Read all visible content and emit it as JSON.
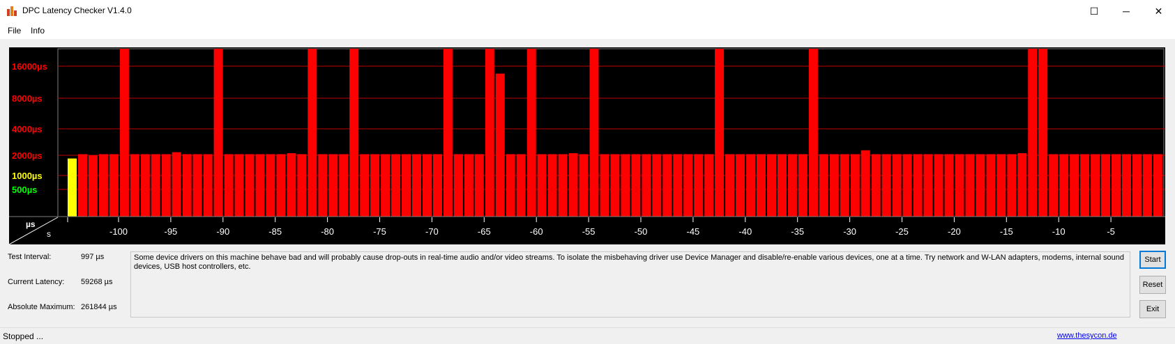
{
  "window": {
    "title": "DPC Latency Checker V1.4.0",
    "controls": {
      "minimize": "─",
      "maximize": "☐",
      "close": "✕"
    }
  },
  "menu": {
    "items": [
      "File",
      "Info"
    ]
  },
  "chart": {
    "y_axis_labels": [
      {
        "text": "16000µs",
        "color": "#ff0000"
      },
      {
        "text": "8000µs",
        "color": "#ff0000"
      },
      {
        "text": "4000µs",
        "color": "#ff0000"
      },
      {
        "text": "2000µs",
        "color": "#ff0000"
      },
      {
        "text": "1000µs",
        "color": "#ffff00"
      },
      {
        "text": "500µs",
        "color": "#00ff00"
      }
    ],
    "corner": {
      "top": "µs",
      "bottom": "s"
    },
    "x_ticks": [
      "-100",
      "-95",
      "-90",
      "-85",
      "-80",
      "-75",
      "-70",
      "-65",
      "-60",
      "-55",
      "-50",
      "-45",
      "-40",
      "-35",
      "-30",
      "-25",
      "-20",
      "-15",
      "-10",
      "-5"
    ]
  },
  "chart_data": {
    "type": "bar",
    "x_unit": "s",
    "y_unit": "µs",
    "y_scale": "log",
    "x_range": [
      -104,
      0
    ],
    "y_ticks": [
      500,
      1000,
      2000,
      4000,
      8000,
      16000
    ],
    "gridlines": true,
    "values": [
      1950,
      2150,
      2100,
      2150,
      2150,
      30000,
      2150,
      2150,
      2150,
      2150,
      2250,
      2150,
      2150,
      2150,
      30000,
      2150,
      2150,
      2150,
      2150,
      2150,
      2150,
      2200,
      2150,
      30000,
      2150,
      2150,
      2150,
      30000,
      2150,
      2150,
      2150,
      2150,
      2150,
      2150,
      2150,
      2150,
      30000,
      2150,
      2150,
      2150,
      30000,
      13500,
      2150,
      2150,
      30000,
      2150,
      2150,
      2150,
      2200,
      2150,
      30000,
      2150,
      2150,
      2150,
      2150,
      2150,
      2150,
      2150,
      2150,
      2150,
      2150,
      2150,
      30000,
      2150,
      2150,
      2150,
      2150,
      2150,
      2150,
      2150,
      2150,
      30000,
      2150,
      2150,
      2150,
      2150,
      2350,
      2150,
      2150,
      2150,
      2150,
      2150,
      2150,
      2150,
      2150,
      2150,
      2150,
      2150,
      2150,
      2150,
      2150,
      2200,
      30000,
      30000,
      2150,
      2150,
      2150,
      2150,
      2150,
      2150,
      2150,
      2150,
      2150,
      2150,
      2150
    ],
    "colors": {
      "red": "#ff0000",
      "yellow": "#ffff00",
      "green": "#00ff00",
      "background": "#000000"
    }
  },
  "stats": {
    "test_interval_label": "Test Interval:",
    "test_interval_value": "997 µs",
    "current_latency_label": "Current Latency:",
    "current_latency_value": "59268 µs",
    "absolute_max_label": "Absolute Maximum:",
    "absolute_max_value": "261844 µs"
  },
  "message": "Some device drivers on this machine behave bad and will probably cause drop-outs in real-time audio and/or video streams. To isolate the misbehaving driver use Device Manager and disable/re-enable various devices, one at a time. Try network and W-LAN adapters, modems, internal sound devices, USB host controllers, etc.",
  "buttons": {
    "start": "Start",
    "reset": "Reset",
    "exit": "Exit"
  },
  "status": {
    "text": "Stopped ...",
    "link": "www.thesycon.de"
  },
  "accent": "#0078d7"
}
